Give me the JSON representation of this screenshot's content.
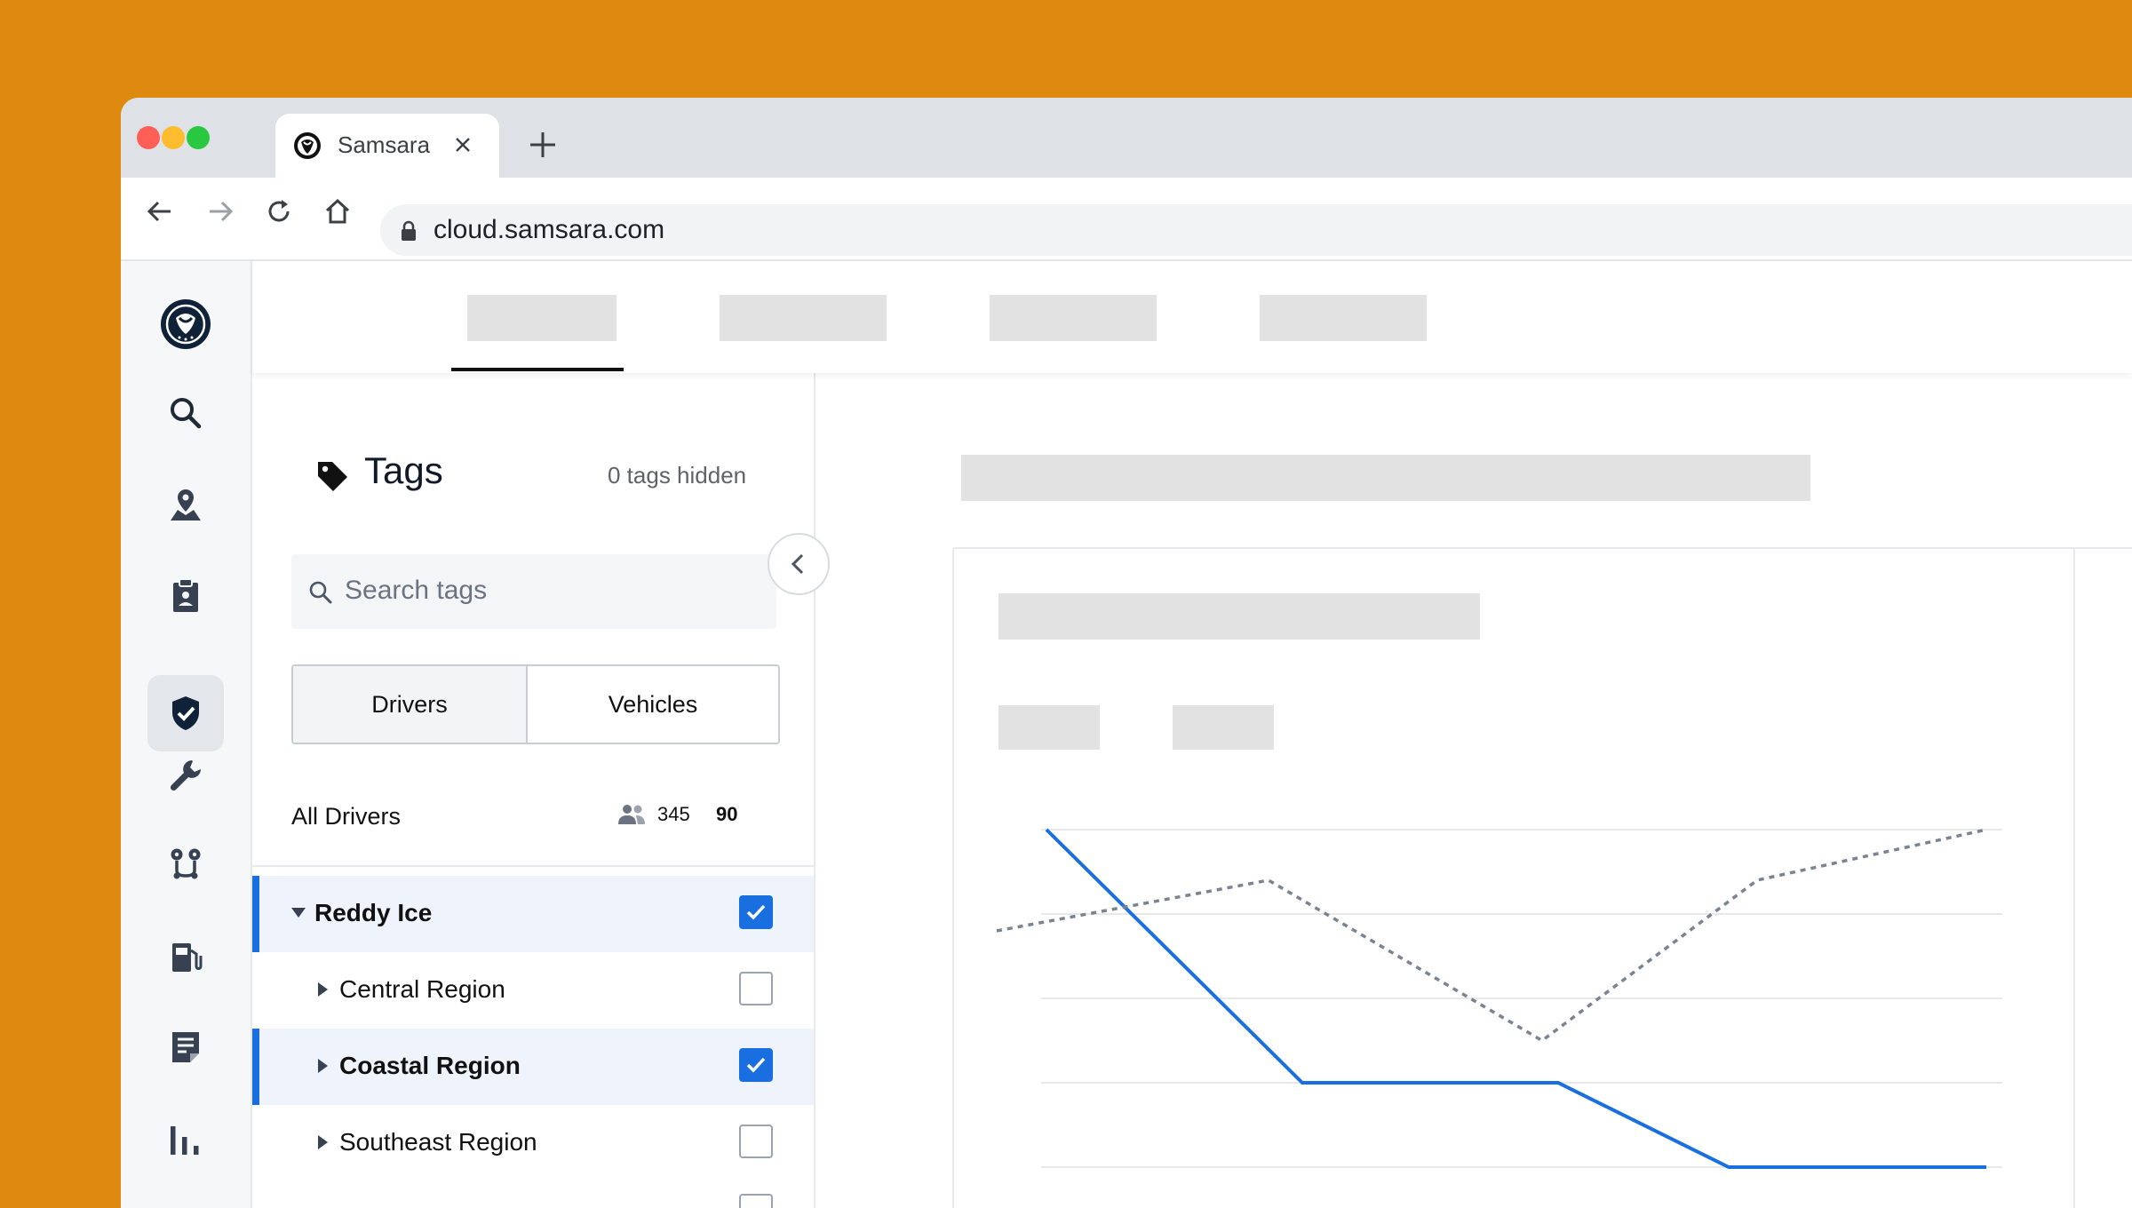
{
  "browser": {
    "tab_title": "Samsara",
    "url": "cloud.samsara.com",
    "traffic_lights": [
      "#FF5F57",
      "#FEBC2E",
      "#28C840"
    ]
  },
  "sidebar": {
    "items": [
      "logo-icon",
      "search-icon",
      "map-pin-icon",
      "clipboard-icon",
      "shield-check-icon",
      "wrench-icon",
      "route-icon",
      "fuel-icon",
      "document-icon",
      "bar-chart-icon"
    ],
    "selected": "shield-check-icon"
  },
  "tags_panel": {
    "title": "Tags",
    "hidden_label": "0 tags hidden",
    "search_placeholder": "Search tags",
    "segments": [
      "Drivers",
      "Vehicles"
    ],
    "active_segment": "Drivers",
    "all_label": "All Drivers",
    "all_count": "345",
    "all_selected": "90",
    "rows": [
      {
        "label": "Reddy Ice",
        "checked": true,
        "expanded": true
      },
      {
        "label": "Central Region",
        "checked": false,
        "expanded": false
      },
      {
        "label": "Coastal Region",
        "checked": true,
        "expanded": false
      },
      {
        "label": "Southeast Region",
        "checked": false,
        "expanded": false
      }
    ]
  },
  "colors": {
    "background": "#DE890F",
    "accent": "#1A6FE0",
    "series_dashed": "#7A8390",
    "placeholder": "#E2E2E2"
  },
  "chart_data": {
    "type": "line",
    "x": [
      0,
      1,
      2,
      3,
      4,
      5
    ],
    "series": [
      {
        "style": "solid",
        "color": "#1A6FE0",
        "values": [
          4.0,
          1.0,
          1.0,
          0.0,
          0.0
        ]
      },
      {
        "style": "dashed",
        "color": "#7A8390",
        "values": [
          2.8,
          3.4,
          1.5,
          3.4,
          4.0
        ]
      }
    ],
    "ylim": [
      0,
      4
    ],
    "grid": true
  }
}
